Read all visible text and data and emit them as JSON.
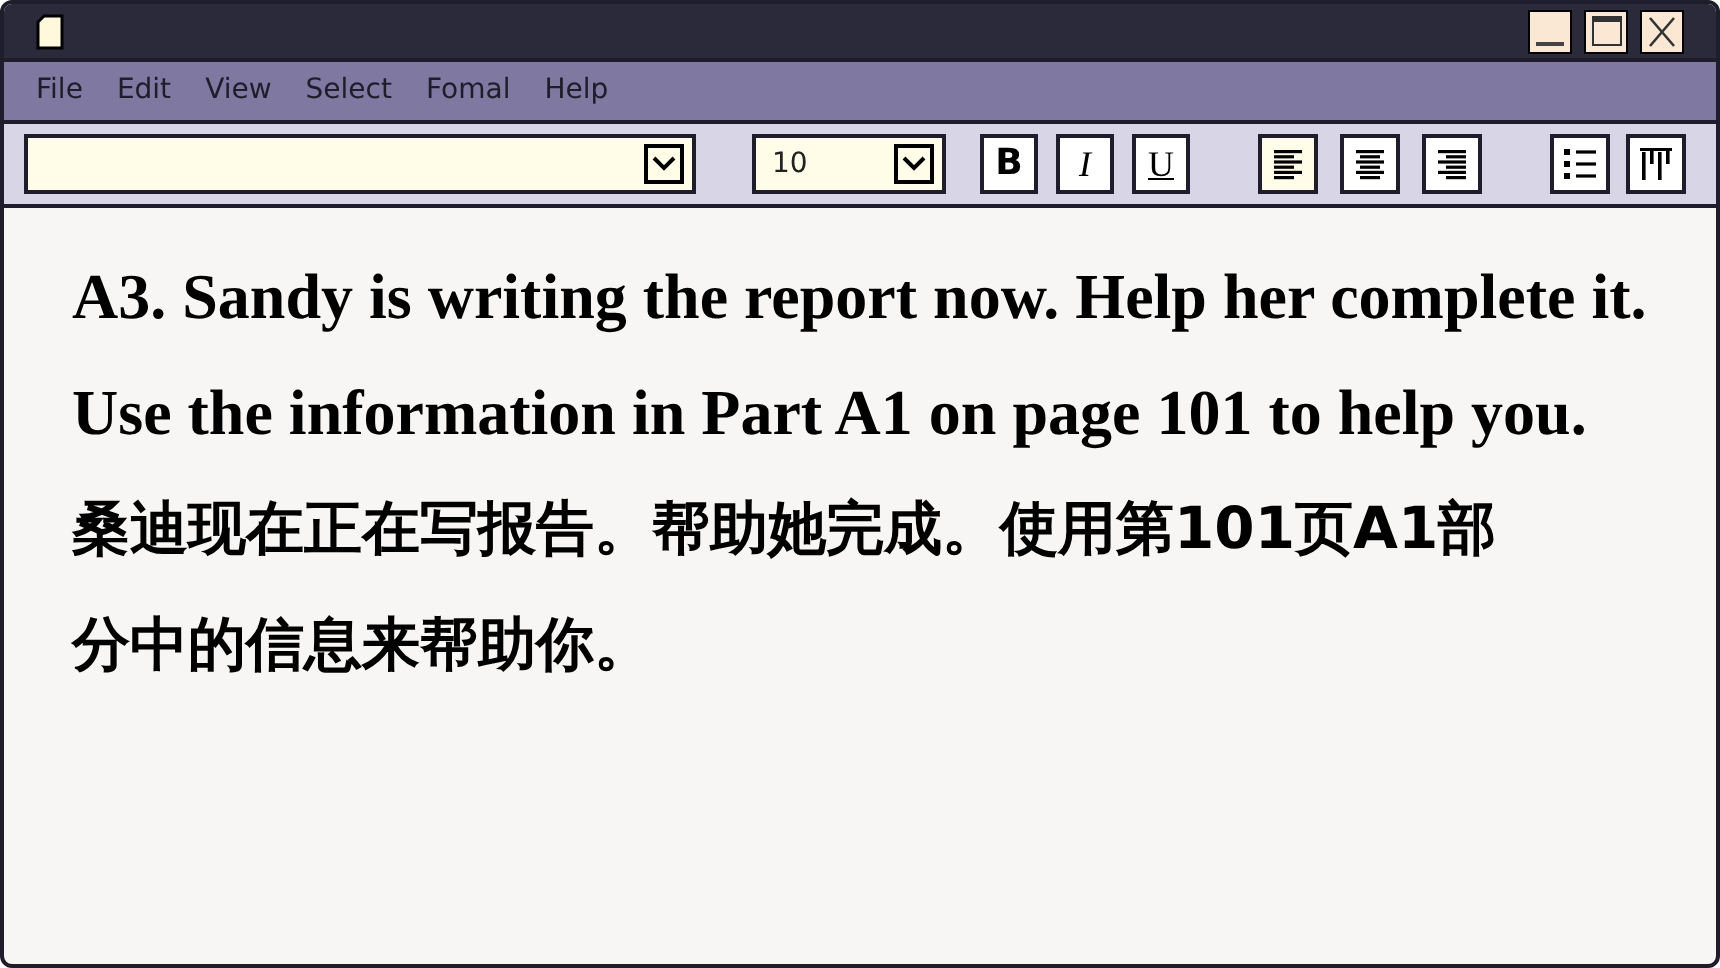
{
  "menu": [
    "File",
    "Edit",
    "View",
    "Select",
    "Fomal",
    "Help"
  ],
  "toolbar": {
    "size": "10",
    "format_buttons": [
      {
        "label": "B",
        "kind": "bold",
        "selected": false
      },
      {
        "label": "I",
        "kind": "italic",
        "selected": false
      },
      {
        "label": "U",
        "kind": "underline",
        "selected": false
      }
    ],
    "align_buttons": [
      {
        "kind": "left",
        "selected": true
      },
      {
        "kind": "center",
        "selected": false
      },
      {
        "kind": "right",
        "selected": false
      }
    ],
    "list_buttons": [
      {
        "kind": "bullets"
      },
      {
        "kind": "columns"
      }
    ]
  },
  "document": {
    "lines": [
      {
        "kind": "en",
        "text": "A3. Sandy is writing the report now. Help her complete it."
      },
      {
        "kind": "en",
        "text": "Use the information in Part A1 on page 101 to help you."
      },
      {
        "kind": "zh",
        "text": "桑迪现在正在写报告。帮助她完成。使用第101页A1部"
      },
      {
        "kind": "zh",
        "text": "分中的信息来帮助你。"
      }
    ]
  }
}
